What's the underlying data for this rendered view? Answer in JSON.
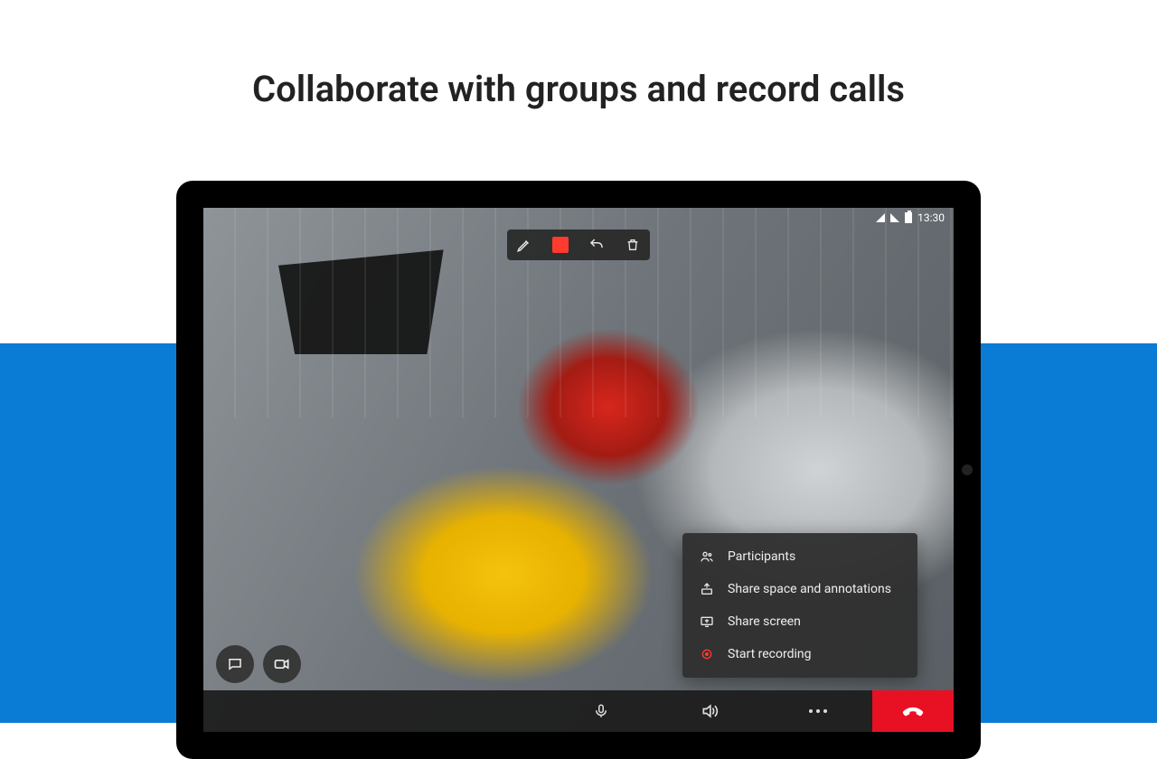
{
  "headline": "Collaborate with groups and record calls",
  "status": {
    "time": "13:30"
  },
  "annotation_toolbar": {
    "items": [
      "pen",
      "color",
      "undo",
      "clear"
    ]
  },
  "popup_menu": {
    "items": [
      {
        "icon": "participants-icon",
        "label": "Participants"
      },
      {
        "icon": "share-space-icon",
        "label": "Share space and annotations"
      },
      {
        "icon": "share-screen-icon",
        "label": "Share screen"
      },
      {
        "icon": "record-icon",
        "label": "Start recording"
      }
    ]
  },
  "bottom_bar": {
    "buttons": [
      "mic",
      "speaker",
      "more",
      "end"
    ]
  },
  "floating_buttons": [
    "chat",
    "toggle-camera"
  ],
  "colors": {
    "brand_blue": "#0a7cd5",
    "danger": "#e81123",
    "recording": "#ff3b30"
  }
}
